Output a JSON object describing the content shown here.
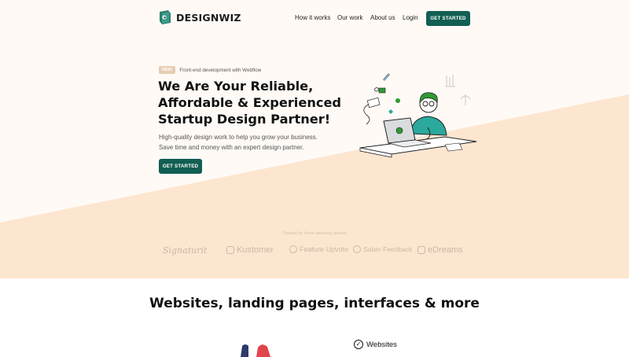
{
  "nav": {
    "logo_text": "DESIGNWIZ",
    "links": [
      "How it works",
      "Our work",
      "About us",
      "Login"
    ],
    "cta_label": "GET STARTED"
  },
  "hero": {
    "badge": "NEW!",
    "badge_text": "Front-end development with Webflow",
    "headline_lines": [
      "We Are Your Reliable,",
      "Affordable & Experienced",
      "Startup Design Partner!"
    ],
    "subtext_lines": [
      "High-quality design work to help you grow your business.",
      "Save time and money with an expert design partner."
    ],
    "cta_label": "GET STARTED"
  },
  "brands": {
    "trusted_text": "Trusted by these amazing brands",
    "items": [
      "Signaturit",
      "Kustomer",
      "Feature Upvote",
      "Saber Feedback",
      "eDreams"
    ]
  },
  "section": {
    "title": "Websites, landing pages, interfaces & more",
    "feature_label": "Websites"
  },
  "colors": {
    "brand_green": "#125e53",
    "peach": "#fde6d0",
    "hero_bg": "#fffaf6",
    "badge_bg": "#e6cdb3",
    "accent_teal": "#2aa99c"
  }
}
